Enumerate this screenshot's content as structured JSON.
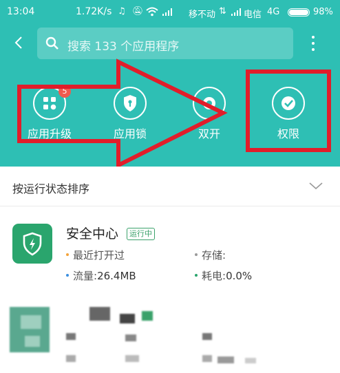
{
  "status_bar": {
    "time": "13:04",
    "speed": "1.72K/s",
    "carrier1": "移不动",
    "carrier2": "电信",
    "network": "4G",
    "battery": "98%"
  },
  "search": {
    "placeholder": "搜索 133 个应用程序"
  },
  "actions": [
    {
      "label": "应用升级",
      "badge": "5"
    },
    {
      "label": "应用锁"
    },
    {
      "label": "双开"
    },
    {
      "label": "权限"
    }
  ],
  "sort": {
    "label": "按运行状态排序"
  },
  "apps": [
    {
      "name": "安全中心",
      "status": "运行中",
      "last_opened": "最近打开过",
      "storage_label": "存储:",
      "traffic_label": "流量:",
      "traffic_value": "26.4MB",
      "power_label": "耗电:",
      "power_value": "0.0%"
    }
  ],
  "colors": {
    "header": "#2ebfb4",
    "annotation": "#e11d2a",
    "app_icon": "#2aa56d",
    "running": "#3aa16a"
  }
}
